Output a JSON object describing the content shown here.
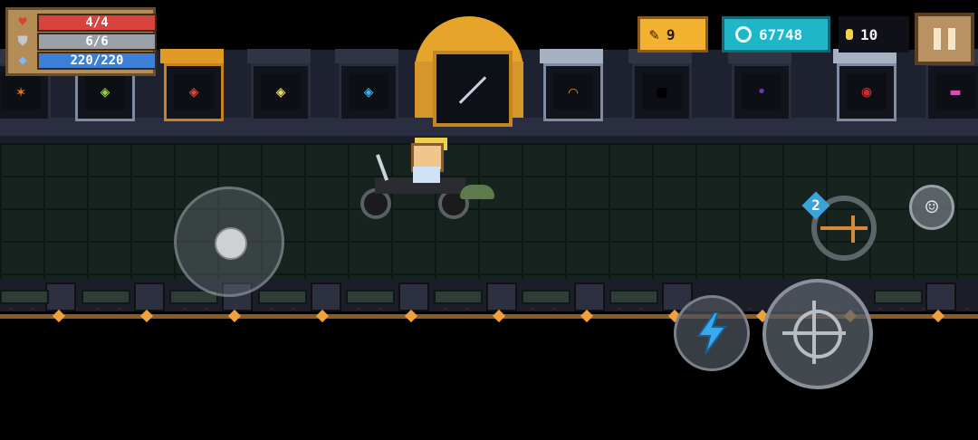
{
  "hud": {
    "health": {
      "text": "4/4",
      "value": 4,
      "max": 4,
      "color": "#d9433d",
      "icon": "heart-icon"
    },
    "armor": {
      "text": "6/6",
      "value": 6,
      "max": 6,
      "color": "#9aa0a8",
      "icon": "shield-icon"
    },
    "energy": {
      "text": "220/220",
      "value": 220,
      "max": 220,
      "color": "#3b7fd6",
      "icon": "diamond-icon"
    }
  },
  "currency": {
    "fish": "9",
    "gems": "67748",
    "coins": "10"
  },
  "skill": {
    "level": "2"
  },
  "colors": {
    "gold": "#e7a42a",
    "gem": "#1fb7c8",
    "fish": "#f2b22f"
  }
}
